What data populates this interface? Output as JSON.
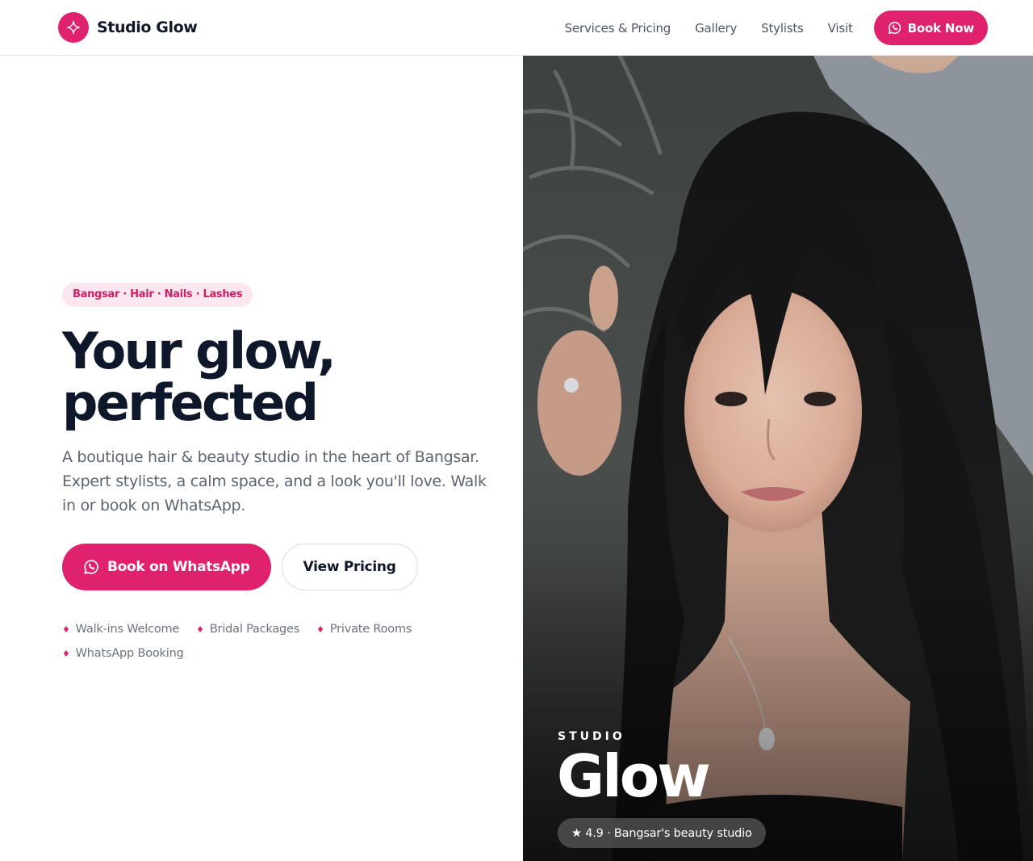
{
  "brand": {
    "name": "Studio Glow",
    "accent_color": "#e0226e",
    "logo_icon": "sparkle-icon"
  },
  "nav": {
    "links": [
      "Services & Pricing",
      "Gallery",
      "Stylists",
      "Visit"
    ],
    "cta_label": "Book Now",
    "cta_icon": "whatsapp-icon"
  },
  "hero": {
    "tag": "Bangsar · Hair · Nails · Lashes",
    "headline_line1": "Your glow,",
    "headline_line2": "perfected",
    "lead": "A boutique hair & beauty studio in the heart of Bangsar. Expert stylists, a calm space, and a look you'll love. Walk in or book on WhatsApp.",
    "primary_cta": "Book on WhatsApp",
    "secondary_cta": "View Pricing",
    "features": [
      "Walk-ins Welcome",
      "Bridal Packages",
      "Private Rooms",
      "WhatsApp Booking"
    ],
    "feature_bullet": "♦"
  },
  "photo_panel": {
    "kicker": "STUDIO",
    "title": "Glow",
    "rating": "★ 4.9 · Bangsar's beauty studio"
  }
}
